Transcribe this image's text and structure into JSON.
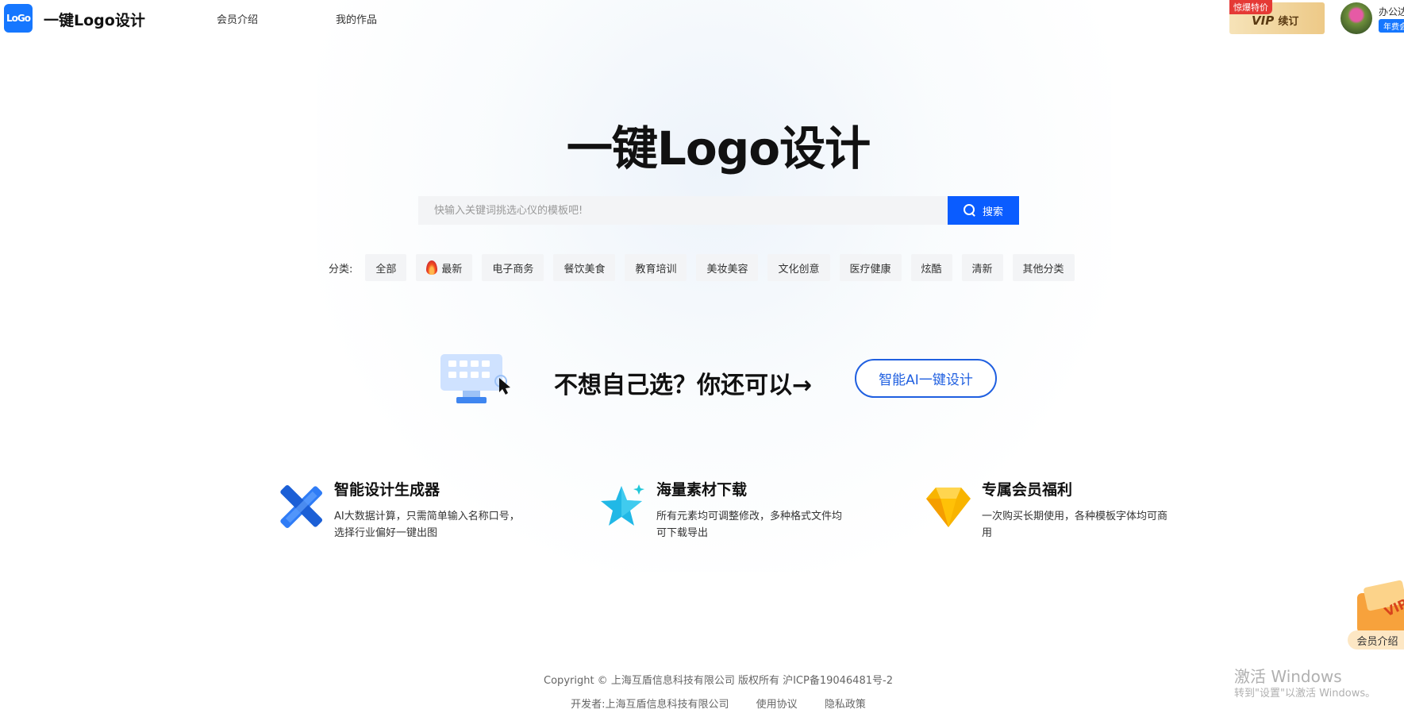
{
  "header": {
    "logo_text": "LoGo",
    "brand": "一键Logo设计",
    "nav": [
      "会员介绍",
      "我的作品"
    ],
    "vip_tag": "惊爆特价",
    "vip_label": "VIP",
    "vip_renew": "续订",
    "user_name": "办公达人",
    "user_badge": "年费会员"
  },
  "hero": {
    "title": "一键Logo设计",
    "search_placeholder": "快输入关键词挑选心仪的模板吧!",
    "search_button": "搜索"
  },
  "categories": {
    "label": "分类:",
    "items": [
      "全部",
      "最新",
      "电子商务",
      "餐饮美食",
      "教育培训",
      "美妆美容",
      "文化创意",
      "医疗健康",
      "炫酷",
      "清新",
      "其他分类"
    ]
  },
  "promo": {
    "text": "不想自己选？你还可以→",
    "ai_button": "智能AI一键设计"
  },
  "features": [
    {
      "title": "智能设计生成器",
      "desc": "AI大数据计算，只需简单输入名称口号，选择行业偏好一键出图",
      "icon": "pencil-ruler-icon"
    },
    {
      "title": "海量素材下载",
      "desc": "所有元素均可调整修改，多种格式文件均可下载导出",
      "icon": "star-icon"
    },
    {
      "title": "专属会员福利",
      "desc": "一次购买长期使用，各种模板字体均可商用",
      "icon": "diamond-icon"
    }
  ],
  "footer": {
    "copyright": "Copyright © 上海互盾信息科技有限公司 版权所有 沪ICP备19046481号-2",
    "developer": "开发者:上海互盾信息科技有限公司",
    "terms": "使用协议",
    "privacy": "隐私政策"
  },
  "side_widget": {
    "vip_text": "VIP",
    "label": "会员介绍"
  },
  "watermark": {
    "line1": "激活 Windows",
    "line2": "转到\"设置\"以激活 Windows。"
  },
  "colors": {
    "primary": "#0a5cff",
    "accent_blue": "#1f5fe0",
    "vip_gold": "#edc987"
  }
}
